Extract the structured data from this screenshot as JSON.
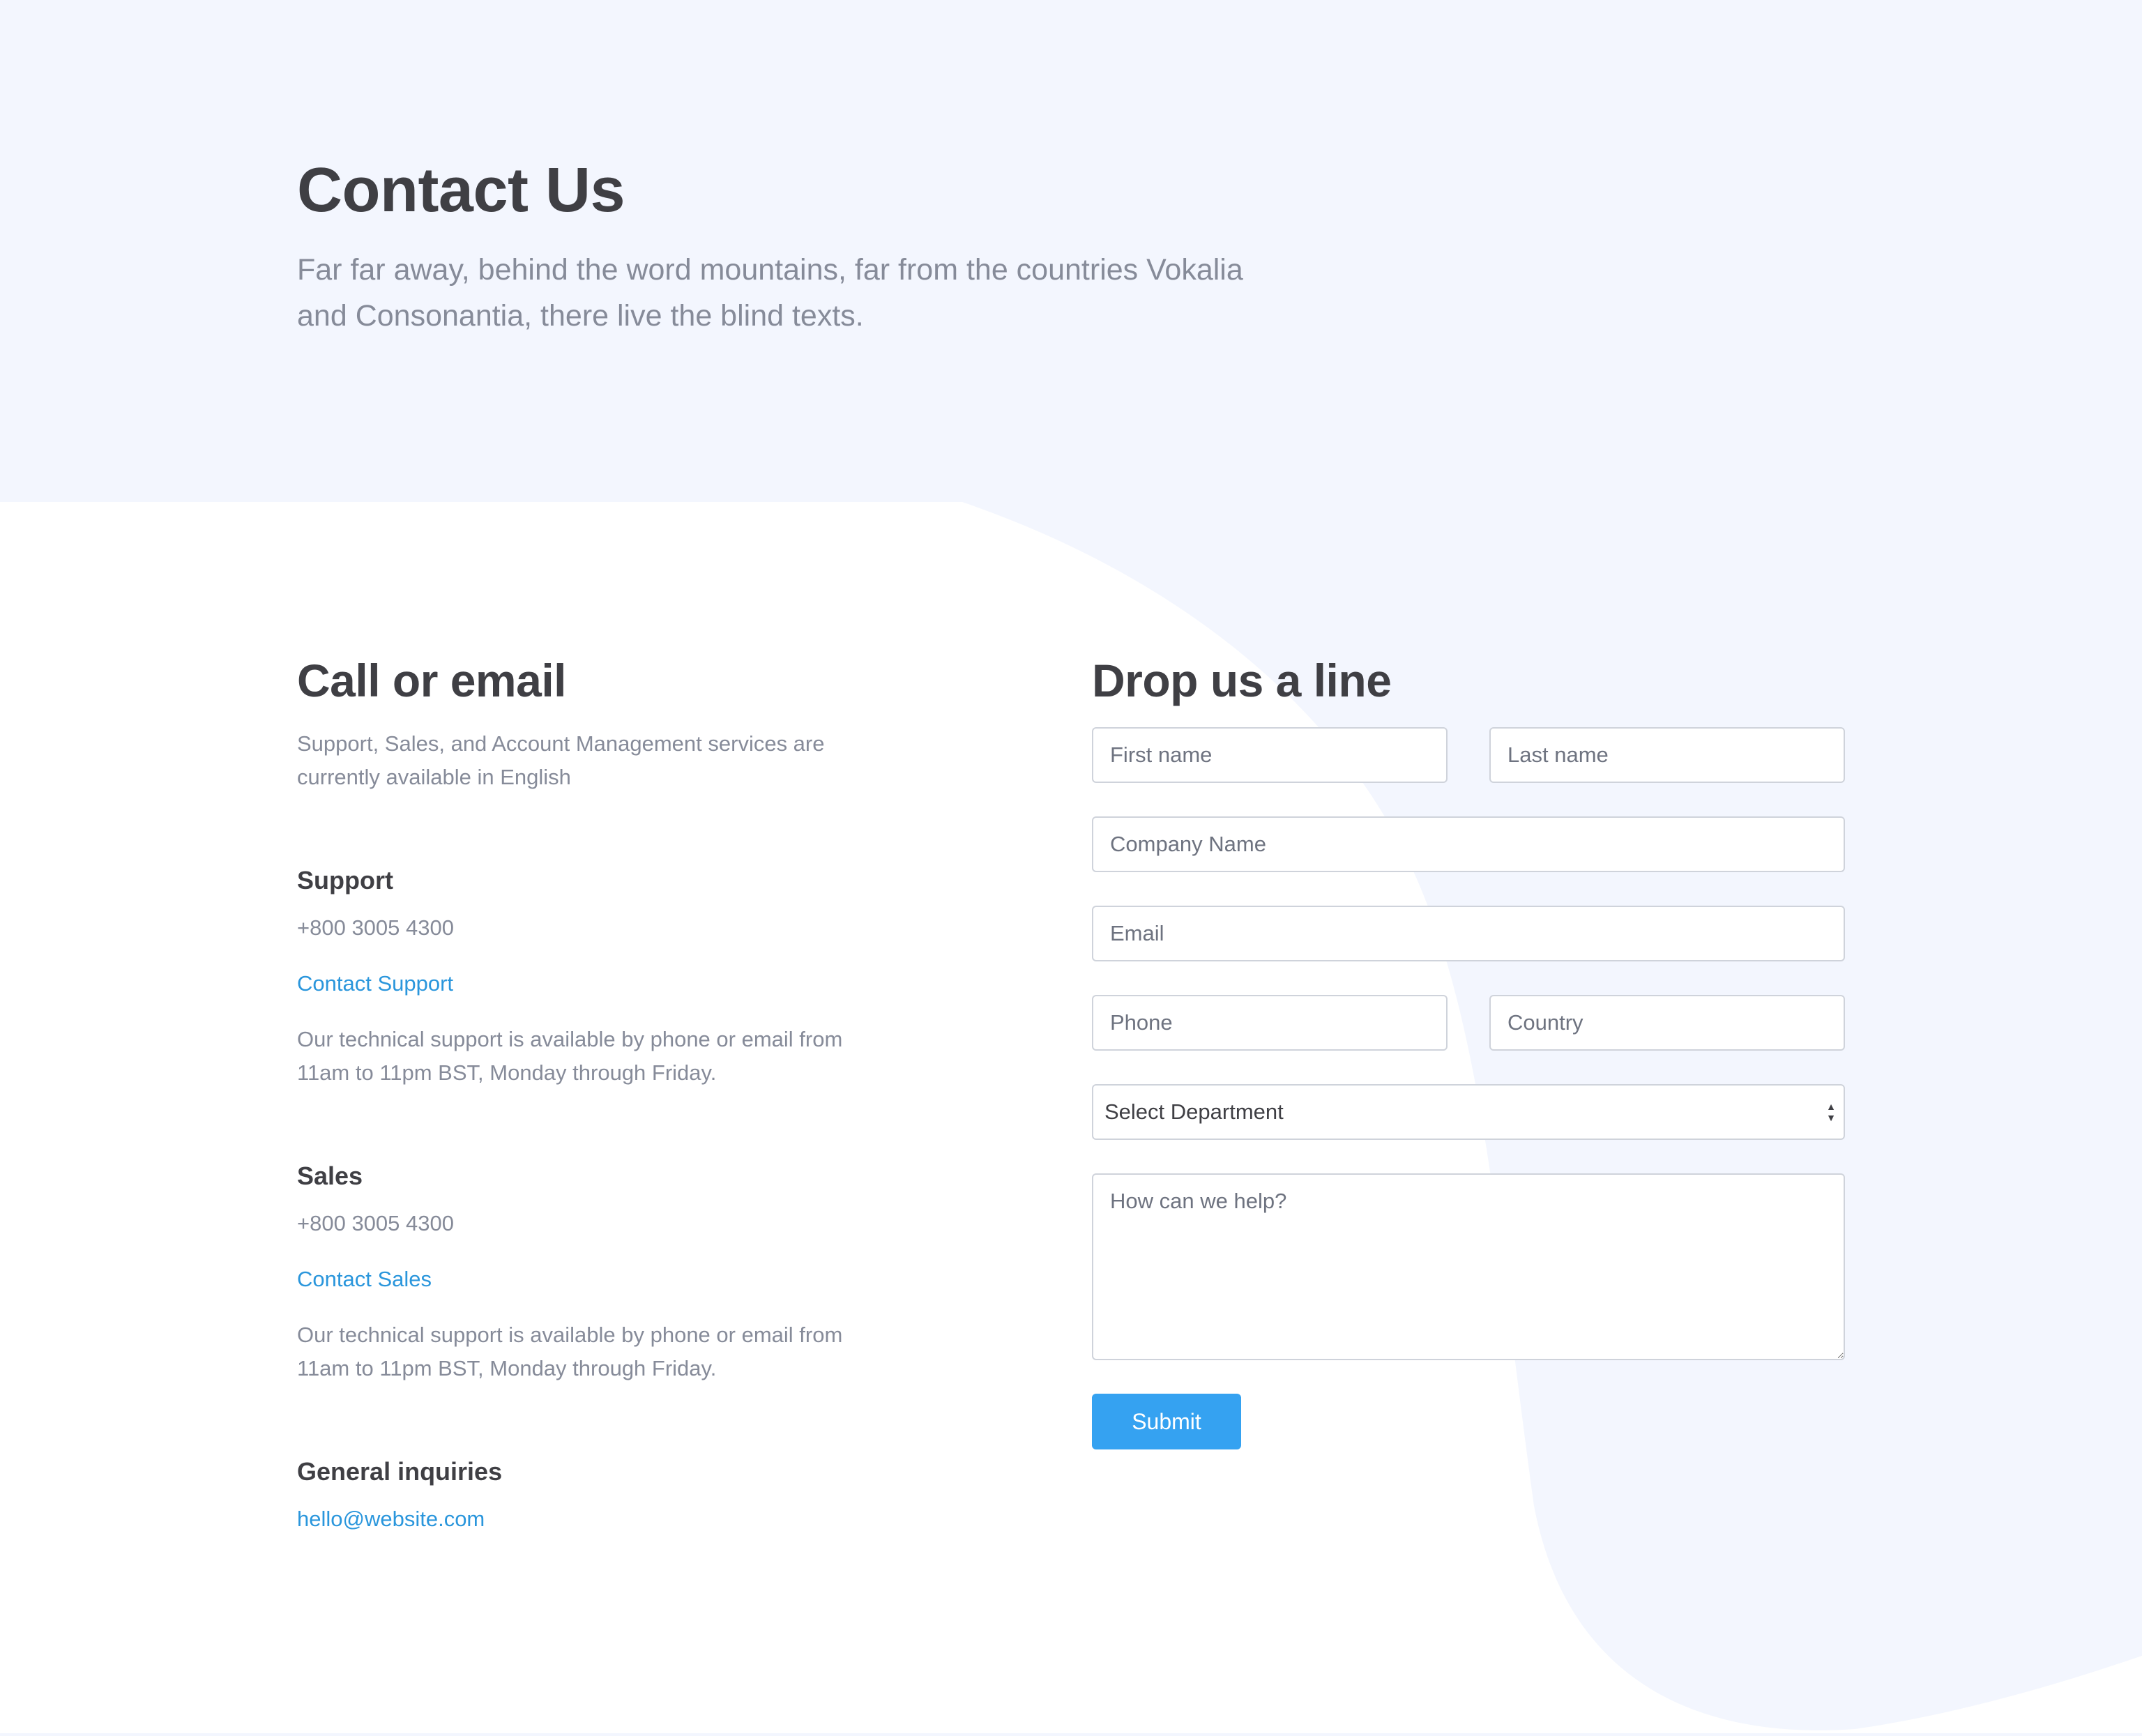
{
  "hero": {
    "title": "Contact Us",
    "subtitle": "Far far away, behind the word mountains, far from the countries Vokalia and Consonantia, there live the blind texts."
  },
  "contact": {
    "title": "Call or email",
    "intro": "Support, Sales, and Account Management services are currently available in English",
    "support": {
      "title": "Support",
      "phone": "+800 3005 4300",
      "link": "Contact Support",
      "note": "Our technical support is available by phone or email from 11am to 11pm BST, Monday through Friday."
    },
    "sales": {
      "title": "Sales",
      "phone": "+800 3005 4300",
      "link": "Contact Sales",
      "note": "Our technical support is available by phone or email from 11am to 11pm BST, Monday through Friday."
    },
    "general": {
      "title": "General inquiries",
      "email": "hello@website.com"
    }
  },
  "form": {
    "title": "Drop us a line",
    "first_name_placeholder": "First name",
    "last_name_placeholder": "Last name",
    "company_placeholder": "Company Name",
    "email_placeholder": "Email",
    "phone_placeholder": "Phone",
    "country_placeholder": "Country",
    "department_selected": "Select Department",
    "message_placeholder": "How can we help?",
    "submit_label": "Submit"
  },
  "colors": {
    "background_tint": "#f3f6fe",
    "heading": "#3f3f44",
    "body_text": "#868b99",
    "link": "#2a96dc",
    "button": "#35a2f1"
  }
}
